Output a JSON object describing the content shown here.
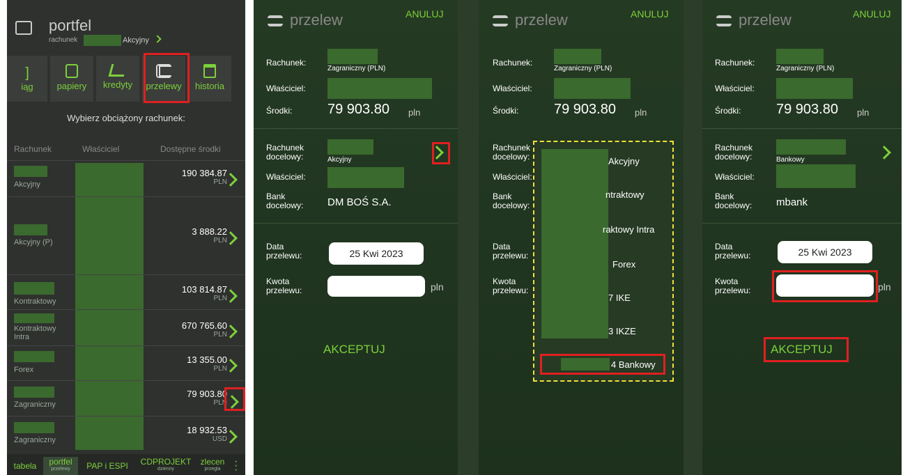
{
  "panel1": {
    "title": "portfel",
    "subtitle_prefix": "rachunek",
    "subtitle_suffix": "Akcyjny",
    "tabs": [
      {
        "label": "iąg"
      },
      {
        "label": "papiery"
      },
      {
        "label": "kredyty"
      },
      {
        "label": "przelewy"
      },
      {
        "label": "historia"
      }
    ],
    "prompt": "Wybierz obciążony rachunek:",
    "headers": {
      "account": "Rachunek",
      "owner": "Właściciel",
      "funds": "Dostępne środki"
    },
    "rows": [
      {
        "type": "Akcyjny",
        "amount": "190 384.87",
        "currency": "PLN"
      },
      {
        "type": "Akcyjny (P)",
        "amount": "3 888.22",
        "currency": "PLN"
      },
      {
        "type": "Kontraktowy",
        "amount": "103 814.87",
        "currency": "PLN"
      },
      {
        "type": "Kontraktowy Intra",
        "amount": "670 765.60",
        "currency": "PLN"
      },
      {
        "type": "Forex",
        "amount": "13 355.00",
        "currency": "PLN"
      },
      {
        "type": "Zagraniczny",
        "amount": "79 903.80",
        "currency": "PLN"
      },
      {
        "type": "Zagraniczny",
        "amount": "18 932.53",
        "currency": "USD"
      }
    ],
    "bottom_tabs": [
      {
        "label": "tabela",
        "sub": ""
      },
      {
        "label": "portfel",
        "sub": "przelewy"
      },
      {
        "label": "PAP i ESPI",
        "sub": ""
      },
      {
        "label": "CDPROJEKT",
        "sub": "dzienny"
      },
      {
        "label": "zlecen",
        "sub": "przegla"
      }
    ]
  },
  "transfer": {
    "title": "przelew",
    "cancel": "ANULUJ",
    "account_label": "Rachunek:",
    "account_type": "Zagraniczny (PLN)",
    "owner_label": "Właściciel:",
    "funds_label": "Środki:",
    "funds_value": "79 903.80",
    "funds_unit": "pln",
    "target_label": "Rachunek docelowy:",
    "target_owner_label": "Właściciel:",
    "bank_label": "Bank docelowy:",
    "date_label": "Data przelewu:",
    "date_value": "25 Kwi 2023",
    "amount_label": "Kwota przelewu:",
    "amount_unit": "pln",
    "accept": "AKCEPTUJ"
  },
  "panel2": {
    "target_type": "Akcyjny",
    "bank": "DM BOŚ S.A."
  },
  "panel3": {
    "options": [
      "Akcyjny",
      "ntraktowy",
      "raktowy Intra",
      "Forex",
      "7  IKE",
      "3  IKZE",
      "4  Bankowy"
    ]
  },
  "panel4": {
    "target_type": "Bankowy",
    "bank": "mbank"
  }
}
